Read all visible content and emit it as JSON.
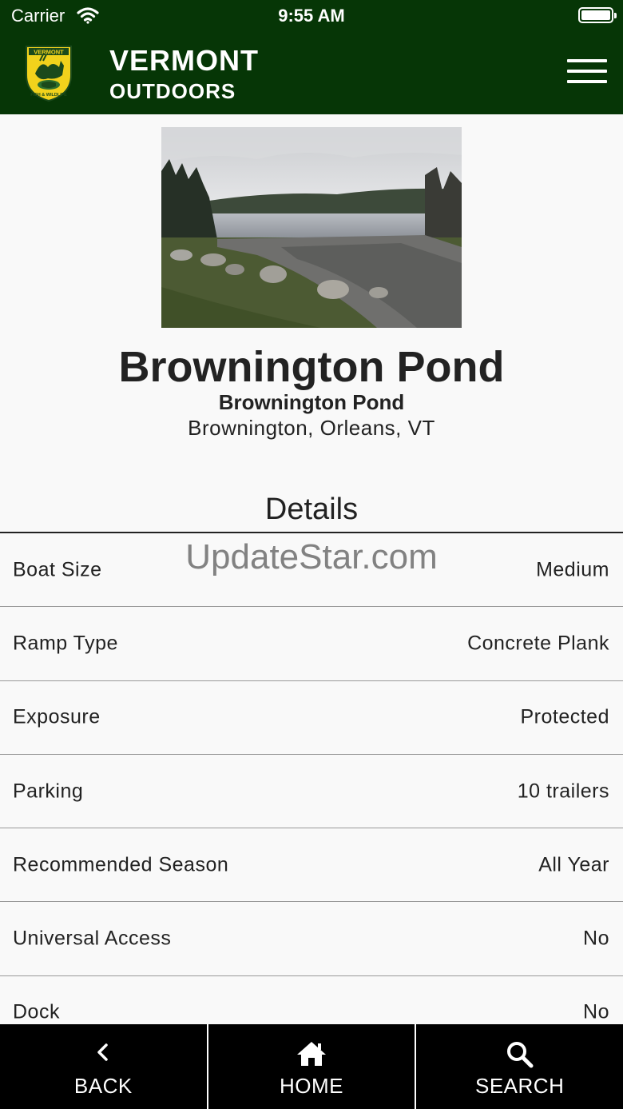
{
  "status_bar": {
    "carrier": "Carrier",
    "time": "9:55 AM"
  },
  "header": {
    "title": "VERMONT",
    "subtitle": "OUTDOORS",
    "logo_text_top": "VERMONT",
    "logo_text_bottom": "FISH & WILDLIFE"
  },
  "place": {
    "title": "Brownington Pond",
    "subtitle": "Brownington Pond",
    "location": "Brownington, Orleans, VT"
  },
  "details": {
    "heading": "Details",
    "rows": [
      {
        "label": "Boat Size",
        "value": "Medium"
      },
      {
        "label": "Ramp Type",
        "value": "Concrete Plank"
      },
      {
        "label": "Exposure",
        "value": "Protected"
      },
      {
        "label": "Parking",
        "value": "10 trailers"
      },
      {
        "label": "Recommended Season",
        "value": "All Year"
      },
      {
        "label": "Universal Access",
        "value": "No"
      },
      {
        "label": "Dock",
        "value": "No"
      }
    ]
  },
  "watermark": "UpdateStar.com",
  "bottom_nav": {
    "back": "BACK",
    "home": "HOME",
    "search": "SEARCH"
  },
  "colors": {
    "header_bg": "#063606",
    "nav_bg": "#000000"
  },
  "icons": [
    "wifi-icon",
    "battery-icon",
    "menu-icon",
    "back-chevron-icon",
    "home-icon",
    "search-icon"
  ]
}
